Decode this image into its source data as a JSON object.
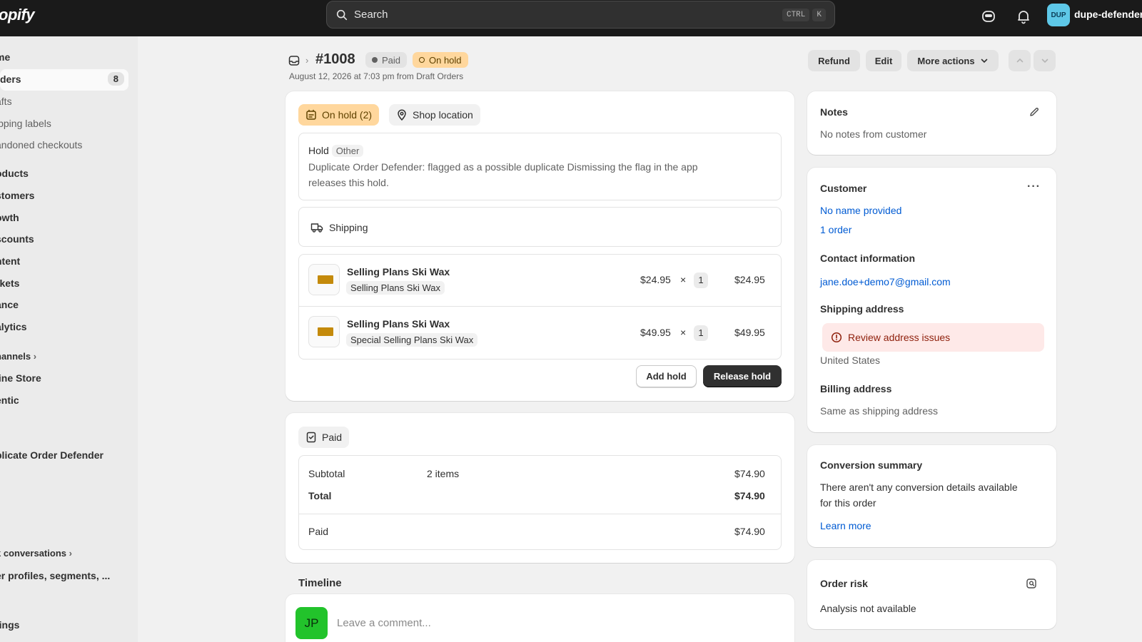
{
  "topbar": {
    "logo": "opify",
    "search_placeholder": "Search",
    "shortcut_ctrl": "CTRL",
    "shortcut_k": "K",
    "avatar_initials": "DUP",
    "store_name": "dupe-defender"
  },
  "sidebar": {
    "items": [
      {
        "label": "me"
      },
      {
        "label": "ders",
        "count": "8"
      },
      {
        "label": "afts"
      },
      {
        "label": "ipping labels"
      },
      {
        "label": "andoned checkouts"
      },
      {
        "label": "oducts"
      },
      {
        "label": "stomers"
      },
      {
        "label": "owth"
      },
      {
        "label": "scounts"
      },
      {
        "label": "ntent"
      },
      {
        "label": "rkets"
      },
      {
        "label": "ance"
      },
      {
        "label": "alytics"
      },
      {
        "label": "hannels"
      },
      {
        "label": "line Store"
      },
      {
        "label": "entic"
      },
      {
        "label": "plicate Order Defender"
      },
      {
        "label": "k conversations"
      },
      {
        "label": "er profiles, segments, ..."
      },
      {
        "label": "tings"
      }
    ]
  },
  "header": {
    "order_number": "#1008",
    "paid_badge": "Paid",
    "hold_badge": "On hold",
    "subtitle": "August 12, 2026 at 7:03 pm from Draft Orders",
    "refund": "Refund",
    "edit": "Edit",
    "more_actions": "More actions"
  },
  "hold_card": {
    "tab_hold": "On hold (2)",
    "tab_location": "Shop location",
    "hold_label": "Hold",
    "hold_tag": "Other",
    "hold_message_1": "Duplicate Order Defender: flagged as a possible duplicate Dismissing the flag in the app",
    "hold_message_2": "releases this hold.",
    "shipping_label": "Shipping",
    "items": [
      {
        "name": "Selling Plans Ski Wax",
        "variant": "Selling Plans Ski Wax",
        "price": "$24.95",
        "x": "×",
        "qty": "1",
        "total": "$24.95"
      },
      {
        "name": "Selling Plans Ski Wax",
        "variant": "Special Selling Plans Ski Wax",
        "price": "$49.95",
        "x": "×",
        "qty": "1",
        "total": "$49.95"
      }
    ],
    "add_hold": "Add hold",
    "release_hold": "Release hold"
  },
  "payment_card": {
    "badge": "Paid",
    "subtotal_label": "Subtotal",
    "subtotal_items": "2 items",
    "subtotal_value": "$74.90",
    "total_label": "Total",
    "total_value": "$74.90",
    "paid_label": "Paid",
    "paid_value": "$74.90"
  },
  "timeline": {
    "title": "Timeline",
    "avatar": "JP",
    "comment_placeholder": "Leave a comment..."
  },
  "notes": {
    "title": "Notes",
    "text": "No notes from customer"
  },
  "customer": {
    "title": "Customer",
    "name": "No name provided",
    "orders": "1 order",
    "contact_title": "Contact information",
    "email": "jane.doe+demo7@gmail.com",
    "shipping_title": "Shipping address",
    "alert": "Review address issues",
    "country": "United States",
    "billing_title": "Billing address",
    "billing_text": "Same as shipping address"
  },
  "conversion": {
    "title": "Conversion summary",
    "text_1": "There aren't any conversion details available",
    "text_2": "for this order",
    "link": "Learn more"
  },
  "risk": {
    "title": "Order risk",
    "text": "Analysis not available"
  },
  "colors": {
    "topbar": "#1a1a1a",
    "link": "#005bd3",
    "hold_badge_bg": "#ffd79d",
    "alert_bg": "#fee9e8",
    "avatar_green": "#22c32b"
  }
}
